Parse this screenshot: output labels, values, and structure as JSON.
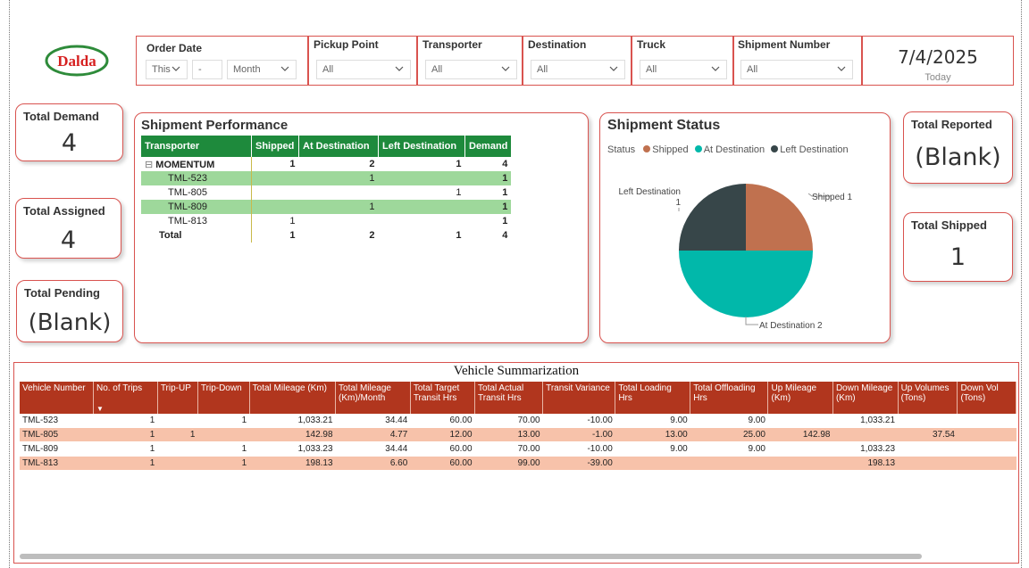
{
  "logo": {
    "text": "Dalda"
  },
  "filters": {
    "order_date": {
      "title": "Order Date",
      "period": "This",
      "separator": "-",
      "unit": "Month"
    },
    "pickup_point": {
      "title": "Pickup Point",
      "value": "All"
    },
    "transporter": {
      "title": "Transporter",
      "value": "All"
    },
    "destination": {
      "title": "Destination",
      "value": "All"
    },
    "truck": {
      "title": "Truck",
      "value": "All"
    },
    "shipment_number": {
      "title": "Shipment Number",
      "value": "All"
    }
  },
  "date_card": {
    "date": "7/4/2025",
    "label": "Today"
  },
  "kpis": {
    "total_demand": {
      "title": "Total Demand",
      "value": "4"
    },
    "total_assigned": {
      "title": "Total Assigned",
      "value": "4"
    },
    "total_pending": {
      "title": "Total Pending",
      "value": "(Blank)"
    },
    "total_reported": {
      "title": "Total Reported",
      "value": "(Blank)"
    },
    "total_shipped": {
      "title": "Total Shipped",
      "value": "1"
    }
  },
  "shipment_performance": {
    "title": "Shipment Performance",
    "headers": [
      "Transporter",
      "Shipped",
      "At Destination",
      "Left Destination",
      "Demand"
    ],
    "group": {
      "expander": "⊟",
      "name": "MOMENTUM",
      "shipped": "1",
      "at_destination": "2",
      "left_destination": "1",
      "demand": "4"
    },
    "rows": [
      {
        "name": "TML-523",
        "shipped": "",
        "at_destination": "1",
        "left_destination": "",
        "demand": "1"
      },
      {
        "name": "TML-805",
        "shipped": "",
        "at_destination": "",
        "left_destination": "1",
        "demand": "1"
      },
      {
        "name": "TML-809",
        "shipped": "",
        "at_destination": "1",
        "left_destination": "",
        "demand": "1"
      },
      {
        "name": "TML-813",
        "shipped": "1",
        "at_destination": "",
        "left_destination": "",
        "demand": "1"
      }
    ],
    "total": {
      "name": "Total",
      "shipped": "1",
      "at_destination": "2",
      "left_destination": "1",
      "demand": "4"
    }
  },
  "shipment_status": {
    "title": "Shipment Status",
    "legend_title": "Status",
    "series": [
      {
        "name": "Shipped",
        "value": 1,
        "color": "#c0714f",
        "label": "Shipped 1"
      },
      {
        "name": "At Destination",
        "value": 2,
        "color": "#01b8aa",
        "label": "At Destination 2"
      },
      {
        "name": "Left Destination",
        "value": 1,
        "color": "#374649",
        "label_name": "Left Destination",
        "label_value": "1"
      }
    ]
  },
  "chart_data": {
    "type": "pie",
    "title": "Shipment Status",
    "categories": [
      "Shipped",
      "At Destination",
      "Left Destination"
    ],
    "values": [
      1,
      2,
      1
    ],
    "legend": "top-left"
  },
  "vehicle_summary": {
    "title": "Vehicle Summarization",
    "sort_indicator": "▼",
    "headers": [
      "Vehicle Number",
      "No. of Trips",
      "Trip-UP",
      "Trip-Down",
      "Total Mileage (Km)",
      "Total Mileage (Km)/Month",
      "Total Target Transit Hrs",
      "Total Actual Transit Hrs",
      "Transit Variance",
      "Total Loading Hrs",
      "Total Offloading Hrs",
      "Up Mileage (Km)",
      "Down Mileage (Km)",
      "Up Volumes (Tons)",
      "Down Vol (Tons)"
    ],
    "rows": [
      [
        "TML-523",
        "1",
        "",
        "1",
        "1,033.21",
        "34.44",
        "60.00",
        "70.00",
        "-10.00",
        "9.00",
        "9.00",
        "",
        "1,033.21",
        "",
        ""
      ],
      [
        "TML-805",
        "1",
        "1",
        "",
        "142.98",
        "4.77",
        "12.00",
        "13.00",
        "-1.00",
        "13.00",
        "25.00",
        "142.98",
        "",
        "37.54",
        ""
      ],
      [
        "TML-809",
        "1",
        "",
        "1",
        "1,033.23",
        "34.44",
        "60.00",
        "70.00",
        "-10.00",
        "9.00",
        "9.00",
        "",
        "1,033.23",
        "",
        ""
      ],
      [
        "TML-813",
        "1",
        "",
        "1",
        "198.13",
        "6.60",
        "60.00",
        "99.00",
        "-39.00",
        "",
        "",
        "",
        "198.13",
        "",
        ""
      ]
    ]
  }
}
